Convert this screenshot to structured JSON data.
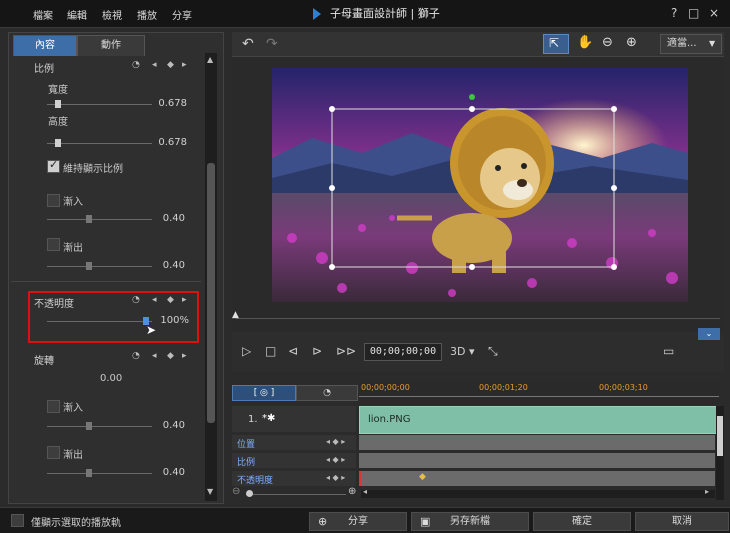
{
  "titlebar": {
    "menus": [
      "檔案",
      "編輯",
      "檢視",
      "播放",
      "分享"
    ],
    "title": "子母畫面設計師 | 獅子",
    "help": "?",
    "maximize": "□",
    "close": "×"
  },
  "panel": {
    "tabs": [
      "內容",
      "動作"
    ],
    "scale": {
      "title": "比例",
      "width_label": "寬度",
      "width_value": "0.678",
      "height_label": "高度",
      "height_value": "0.678",
      "keep_ratio_label": "維持顯示比例"
    },
    "fade_in_label": "漸入",
    "fade_in_value": "0.40",
    "fade_out_label": "漸出",
    "fade_out_value": "0.40",
    "opacity": {
      "title": "不透明度",
      "value": "100%"
    },
    "rotation": {
      "title": "旋轉",
      "value": "0.00",
      "fade_in_label": "漸入",
      "fade_in_value": "0.40",
      "fade_out_label": "漸出",
      "fade_out_value": "0.40"
    }
  },
  "preview": {
    "fit_label": "適當...",
    "timecode": "00;00;00;00",
    "mode_3d": "3D ▾"
  },
  "timeline": {
    "ruler_times": [
      "00;00;00;00",
      "00;00;01;20",
      "00;00;03;10"
    ],
    "track_number": "1.",
    "clip_label": "lion.PNG",
    "rows": [
      "位置",
      "比例",
      "不透明度"
    ]
  },
  "bottom": {
    "show_selected_label": "僅顯示選取的播放軌",
    "share_label": "分享",
    "save_new_label": "另存新檔",
    "ok_label": "確定",
    "cancel_label": "取消"
  }
}
